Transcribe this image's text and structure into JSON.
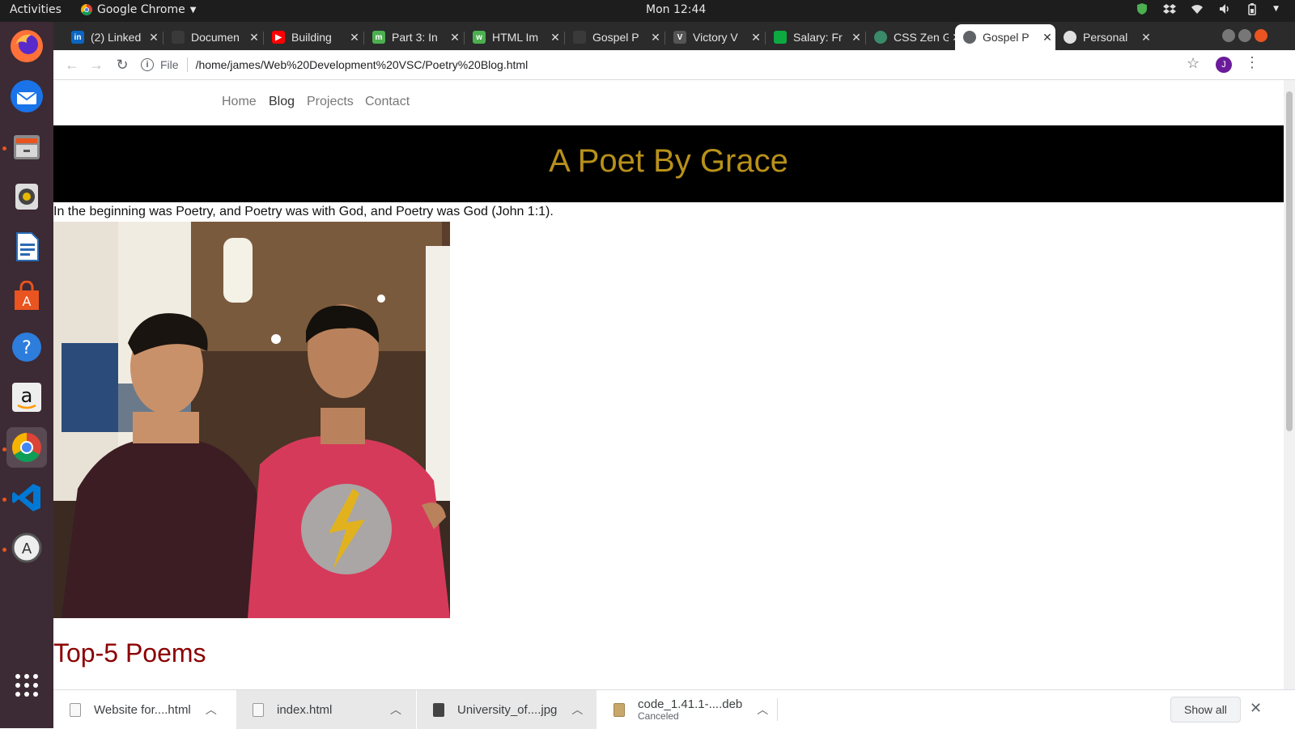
{
  "system": {
    "activities": "Activities",
    "app_name": "Google Chrome",
    "clock": "Mon 12:44"
  },
  "dock": {
    "apps": [
      "firefox-icon",
      "thunderbird-icon",
      "files-icon",
      "rhythmbox-icon",
      "writer-icon",
      "software-center-icon",
      "help-icon",
      "amazon-icon",
      "chrome-icon",
      "vscode-icon",
      "updater-icon",
      "app-grid-icon"
    ]
  },
  "tabs": [
    {
      "title": "(2) Linked",
      "fav_letter": "in",
      "fav_color": "#0a66c2"
    },
    {
      "title": "Documen",
      "fav_letter": "",
      "fav_color": "#3a3a3a"
    },
    {
      "title": "Building",
      "fav_letter": "▶",
      "fav_color": "#ff0000"
    },
    {
      "title": "Part 3: In",
      "fav_letter": "m",
      "fav_color": "#4caf50"
    },
    {
      "title": "HTML Im",
      "fav_letter": "w",
      "fav_color": "#4caf50"
    },
    {
      "title": "Gospel P",
      "fav_letter": "",
      "fav_color": "#3a3a3a"
    },
    {
      "title": "Victory V",
      "fav_letter": "V",
      "fav_color": "#555555"
    },
    {
      "title": "Salary: Fr",
      "fav_letter": "",
      "fav_color": "#0caa41"
    },
    {
      "title": "CSS Zen G",
      "fav_letter": "",
      "fav_color": "#3a8a6a"
    },
    {
      "title": "Gospel P",
      "fav_letter": "",
      "fav_color": "#5f6368",
      "active": true
    },
    {
      "title": "Personal",
      "fav_letter": "",
      "fav_color": "#e0e0e0"
    }
  ],
  "omnibox": {
    "scheme": "File",
    "url": "/home/james/Web%20Development%20VSC/Poetry%20Blog.html",
    "profile_initial": "J"
  },
  "page": {
    "nav": [
      "Home",
      "Blog",
      "Projects",
      "Contact"
    ],
    "hero_title": "A Poet By Grace",
    "verse": "In the beginning was Poetry, and Poetry was with God, and Poetry was God (John 1:1).",
    "section_heading": "Top-5 Poems"
  },
  "downloads": [
    {
      "name": "Website for....html",
      "status": ""
    },
    {
      "name": "index.html",
      "status": ""
    },
    {
      "name": "University_of....jpg",
      "status": ""
    },
    {
      "name": "code_1.41.1-....deb",
      "status": "Canceled"
    }
  ],
  "shelf": {
    "show_all": "Show all"
  },
  "colors": {
    "hero_bg": "#000000",
    "hero_title": "#b8911a",
    "section_heading": "#8b0000",
    "nav_current": "#333333",
    "nav_other": "#777777"
  }
}
